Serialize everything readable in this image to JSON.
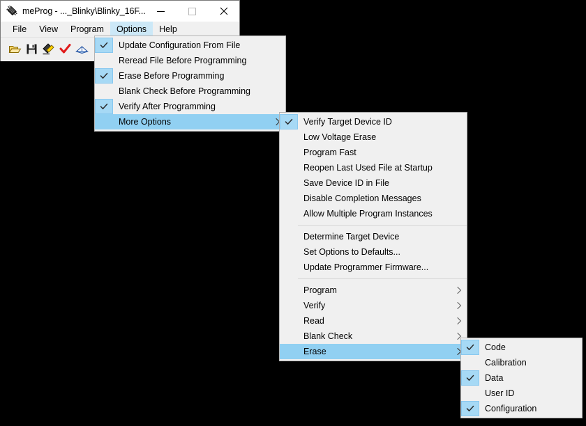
{
  "window": {
    "title": "meProg - ..._Blinky\\Blinky_16F...",
    "icon": "chip-icon",
    "controls": {
      "minimize": "minimize-icon",
      "maximize": "maximize-icon",
      "close": "close-icon"
    }
  },
  "menubar": {
    "items": [
      {
        "label": "File",
        "active": false
      },
      {
        "label": "View",
        "active": false
      },
      {
        "label": "Program",
        "active": false
      },
      {
        "label": "Options",
        "active": true
      },
      {
        "label": "Help",
        "active": false
      }
    ]
  },
  "toolbar": {
    "buttons": [
      {
        "name": "open-file-icon",
        "title": "Open"
      },
      {
        "name": "save-file-icon",
        "title": "Save"
      },
      {
        "name": "program-device-icon",
        "title": "Program"
      },
      {
        "name": "verify-icon",
        "title": "Verify"
      },
      {
        "name": "read-device-icon",
        "title": "Read"
      },
      {
        "name": "blank-check-icon",
        "title": "Blank Check"
      }
    ]
  },
  "menus": {
    "options": {
      "name": "options-menu",
      "items": [
        {
          "label": "Update Configuration From File",
          "checked": true,
          "selected": false,
          "submenu": false
        },
        {
          "label": "Reread File Before Programming",
          "checked": false,
          "selected": false,
          "submenu": false
        },
        {
          "label": "Erase Before Programming",
          "checked": true,
          "selected": false,
          "submenu": false
        },
        {
          "label": "Blank Check Before Programming",
          "checked": false,
          "selected": false,
          "submenu": false
        },
        {
          "label": "Verify After Programming",
          "checked": true,
          "selected": false,
          "submenu": false
        },
        {
          "label": "More Options",
          "checked": false,
          "selected": true,
          "submenu": true
        }
      ]
    },
    "more_options": {
      "name": "more-options-menu",
      "items": [
        {
          "type": "item",
          "label": "Verify Target Device ID",
          "checked": true,
          "selected": false,
          "submenu": false
        },
        {
          "type": "item",
          "label": "Low Voltage Erase",
          "checked": false,
          "selected": false,
          "submenu": false
        },
        {
          "type": "item",
          "label": "Program Fast",
          "checked": false,
          "selected": false,
          "submenu": false
        },
        {
          "type": "item",
          "label": "Reopen Last Used File at Startup",
          "checked": false,
          "selected": false,
          "submenu": false
        },
        {
          "type": "item",
          "label": "Save Device ID in File",
          "checked": false,
          "selected": false,
          "submenu": false
        },
        {
          "type": "item",
          "label": "Disable Completion Messages",
          "checked": false,
          "selected": false,
          "submenu": false
        },
        {
          "type": "item",
          "label": "Allow Multiple Program Instances",
          "checked": false,
          "selected": false,
          "submenu": false
        },
        {
          "type": "separator"
        },
        {
          "type": "item",
          "label": "Determine Target Device",
          "checked": false,
          "selected": false,
          "submenu": false
        },
        {
          "type": "item",
          "label": "Set Options to Defaults...",
          "checked": false,
          "selected": false,
          "submenu": false
        },
        {
          "type": "item",
          "label": "Update Programmer Firmware...",
          "checked": false,
          "selected": false,
          "submenu": false
        },
        {
          "type": "separator"
        },
        {
          "type": "item",
          "label": "Program",
          "checked": false,
          "selected": false,
          "submenu": true
        },
        {
          "type": "item",
          "label": "Verify",
          "checked": false,
          "selected": false,
          "submenu": true
        },
        {
          "type": "item",
          "label": "Read",
          "checked": false,
          "selected": false,
          "submenu": true
        },
        {
          "type": "item",
          "label": "Blank Check",
          "checked": false,
          "selected": false,
          "submenu": true
        },
        {
          "type": "item",
          "label": "Erase",
          "checked": false,
          "selected": true,
          "submenu": true
        }
      ]
    },
    "erase": {
      "name": "erase-submenu",
      "items": [
        {
          "label": "Code",
          "checked": true,
          "selected": false,
          "submenu": false
        },
        {
          "label": "Calibration",
          "checked": false,
          "selected": false,
          "submenu": false
        },
        {
          "label": "Data",
          "checked": true,
          "selected": false,
          "submenu": false
        },
        {
          "label": "User ID",
          "checked": false,
          "selected": false,
          "submenu": false
        },
        {
          "label": "Configuration",
          "checked": true,
          "selected": false,
          "submenu": false
        }
      ]
    }
  },
  "colors": {
    "menu_background": "#f0f0f0",
    "highlight": "#91d0f2",
    "check_background": "#a6d9f5",
    "menubar_active": "#cce8f7",
    "border": "#b4b4b4",
    "desktop": "#000000"
  }
}
